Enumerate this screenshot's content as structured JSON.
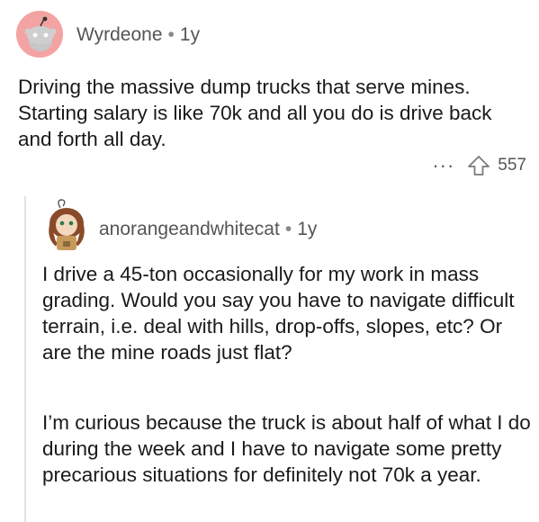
{
  "comment": {
    "username": "Wyrdeone",
    "separator": "•",
    "age": "1y",
    "body": "Driving the massive dump trucks that serve mines. Starting salary is like 70k and all you do is drive back and forth all day.",
    "more_label": "···",
    "upvote_icon": "upvote-arrow-icon",
    "votes": "557"
  },
  "reply": {
    "username": "anorangeandwhitecat",
    "separator": "•",
    "age": "1y",
    "paragraphs": [
      "I drive a 45-ton occasionally for my work in mass grading. Would you say you have to navigate difficult terrain, i.e. deal with hills, drop-offs, slopes, etc? Or are the mine roads just flat?",
      "I’m curious because the truck is about half of what I do during the week and I have to navigate some pretty precarious situations for definitely not 70k a year."
    ]
  },
  "colors": {
    "avatar_bg": "#f4a3a3",
    "thread_line": "#e3e3e3",
    "meta_text": "#555558"
  }
}
